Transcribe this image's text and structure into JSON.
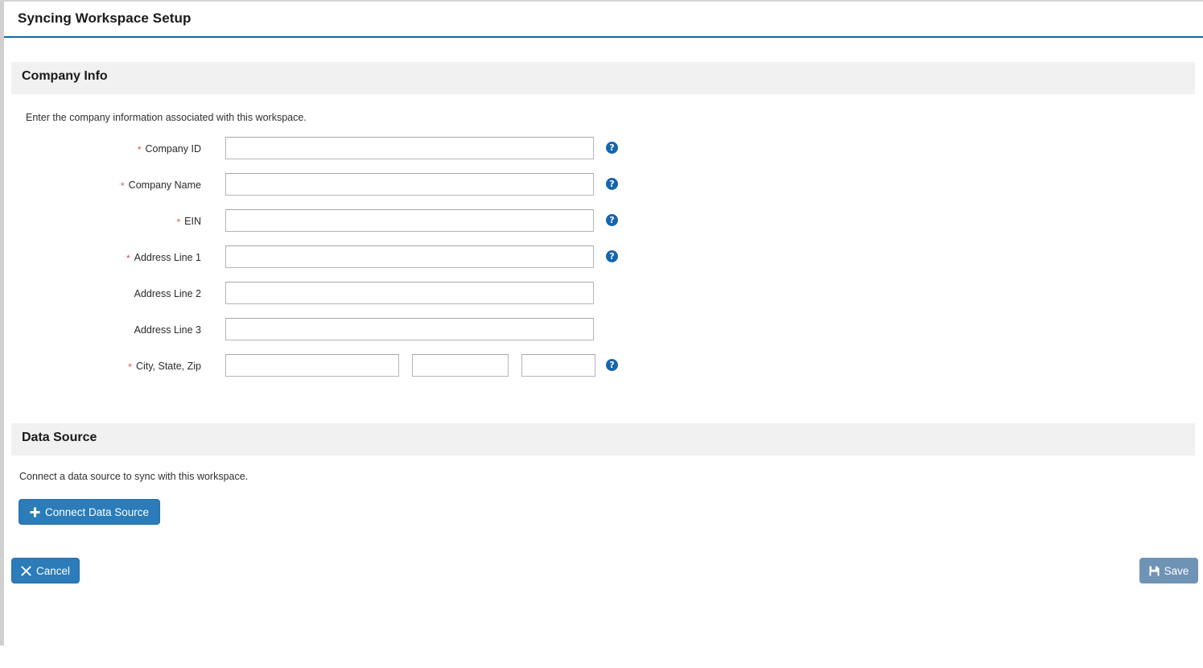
{
  "page": {
    "title": "Syncing Workspace Setup",
    "accent_color": "#0d6aa8",
    "band_color": "#f1f1f1",
    "required_marker": "*",
    "help_icon_glyph": "?",
    "help_icon_name": "question-circle-icon"
  },
  "company_section": {
    "heading": "Company Info",
    "description": "Enter the company information associated with this workspace.",
    "fields": [
      {
        "label": "Company ID",
        "required": true,
        "value": "",
        "placeholder": "",
        "has_help": true,
        "name": "company-id"
      },
      {
        "label": "Company Name",
        "required": true,
        "value": "",
        "placeholder": "",
        "has_help": true,
        "name": "company-name"
      },
      {
        "label": "EIN",
        "required": true,
        "value": "",
        "placeholder": "",
        "has_help": true,
        "name": "ein"
      },
      {
        "label": "Address Line 1",
        "required": true,
        "value": "",
        "placeholder": "",
        "has_help": true,
        "name": "address-line-1"
      },
      {
        "label": "Address Line 2",
        "required": false,
        "value": "",
        "placeholder": "",
        "has_help": false,
        "name": "address-line-2"
      },
      {
        "label": "Address Line 3",
        "required": false,
        "value": "",
        "placeholder": "",
        "has_help": false,
        "name": "address-line-3"
      }
    ],
    "city_state_zip": {
      "label": "City, State, Zip",
      "required": true,
      "has_help": true,
      "city_value": "",
      "city_placeholder": "",
      "state_value": "",
      "state_placeholder": "",
      "zip_value": "",
      "zip_placeholder": ""
    }
  },
  "data_source_section": {
    "heading": "Data Source",
    "description": "Connect a data source to sync with this workspace.",
    "connect_button": {
      "label": "Connect Data Source",
      "icon": "plus-icon",
      "color": "#2b7cb9"
    }
  },
  "footer": {
    "cancel_button": {
      "label": "Cancel",
      "icon": "times-icon",
      "color": "#2b7cb9",
      "enabled": true
    },
    "save_button": {
      "label": "Save",
      "icon": "floppy-disk-icon",
      "color": "#6f93b5",
      "enabled": false
    }
  }
}
